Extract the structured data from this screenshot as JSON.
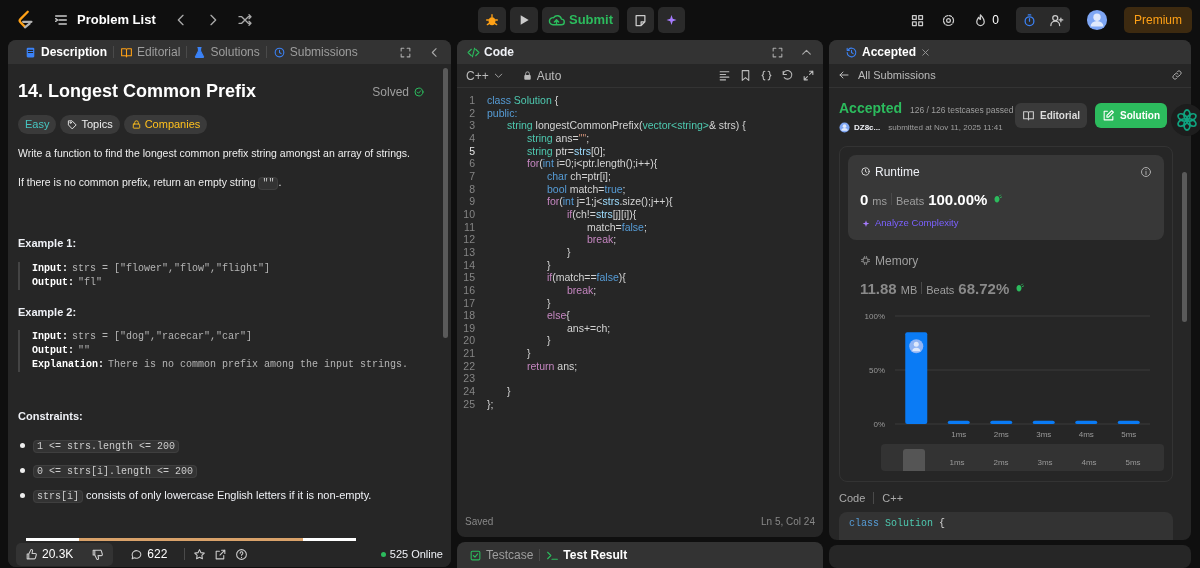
{
  "topbar": {
    "problem_list": "Problem List",
    "submit": "Submit",
    "streak": "0",
    "premium": "Premium"
  },
  "left_panel": {
    "tabs": [
      {
        "label": "Description",
        "selected": true
      },
      {
        "label": "Editorial",
        "selected": false
      },
      {
        "label": "Solutions",
        "selected": false
      },
      {
        "label": "Submissions",
        "selected": false
      }
    ],
    "title": "14. Longest Common Prefix",
    "status": "Solved",
    "tags": [
      {
        "label": "Easy",
        "kind": "difficulty"
      },
      {
        "label": "Topics",
        "kind": "topics"
      },
      {
        "label": "Companies",
        "kind": "locked"
      }
    ],
    "paragraphs": [
      [
        {
          "kind": "text",
          "text": "Write a function to find the longest common prefix string amongst an array of strings."
        }
      ],
      [
        {
          "kind": "text",
          "text": "If there is no common prefix, return an empty string "
        },
        {
          "kind": "code",
          "text": "\"\""
        },
        {
          "kind": "text",
          "text": "."
        }
      ]
    ],
    "examples": [
      {
        "heading": "Example 1:",
        "lines": [
          {
            "label": "Input:",
            "value": "strs = [\"flower\",\"flow\",\"flight\"]"
          },
          {
            "label": "Output:",
            "value": "\"fl\""
          }
        ]
      },
      {
        "heading": "Example 2:",
        "lines": [
          {
            "label": "Input:",
            "value": "strs = [\"dog\",\"racecar\",\"car\"]"
          },
          {
            "label": "Output:",
            "value": "\"\""
          },
          {
            "label": "Explanation:",
            "value": "There is no common prefix among the input strings."
          }
        ]
      }
    ],
    "constraints_heading": "Constraints:",
    "constraints": [
      [
        {
          "kind": "code",
          "text": "1 <= strs.length <= 200"
        }
      ],
      [
        {
          "kind": "code",
          "text": "0 <= strs[i].length <= 200"
        }
      ],
      [
        {
          "kind": "code",
          "text": "strs[i]"
        },
        {
          "kind": "text",
          "text": " consists of only lowercase English letters if it is non-empty."
        }
      ]
    ],
    "footer": {
      "likes": "20.3K",
      "comments": "622",
      "online": "525 Online"
    }
  },
  "code_panel": {
    "title": "Code",
    "language": "C++",
    "mode": "Auto",
    "status": "Saved",
    "cursor": "Ln 5, Col 24",
    "lines": [
      {
        "number": "1",
        "current": false,
        "tokens": [
          {
            "kind": "k",
            "text": "class "
          },
          {
            "kind": "t",
            "text": "Solution"
          },
          {
            "kind": "p",
            "text": " {"
          }
        ]
      },
      {
        "number": "2",
        "current": false,
        "tokens": [
          {
            "kind": "k",
            "text": "public:"
          }
        ]
      },
      {
        "number": "3",
        "current": false,
        "tokens": [
          {
            "kind": "t",
            "text": "\tstring"
          },
          {
            "kind": "p",
            "text": " longestCommonPrefix("
          },
          {
            "kind": "t",
            "text": "vector<string>"
          },
          {
            "kind": "p",
            "text": "& strs) {"
          }
        ]
      },
      {
        "number": "4",
        "current": false,
        "tokens": [
          {
            "kind": "t",
            "text": "\t\tstring"
          },
          {
            "kind": "p",
            "text": " ans="
          },
          {
            "kind": "s",
            "text": "\"\""
          },
          {
            "kind": "p",
            "text": ";"
          }
        ]
      },
      {
        "number": "5",
        "current": true,
        "tokens": [
          {
            "kind": "t",
            "text": "\t\tstring"
          },
          {
            "kind": "p",
            "text": " ptr="
          },
          {
            "kind": "v",
            "text": "strs"
          },
          {
            "kind": "p",
            "text": "[0];"
          }
        ]
      },
      {
        "number": "6",
        "current": false,
        "tokens": [
          {
            "kind": "c",
            "text": "\t\tfor"
          },
          {
            "kind": "p",
            "text": "("
          },
          {
            "kind": "k",
            "text": "int"
          },
          {
            "kind": "p",
            "text": " i=0;i<ptr.length();i++){"
          }
        ]
      },
      {
        "number": "7",
        "current": false,
        "tokens": [
          {
            "kind": "k",
            "text": "\t\t\tchar"
          },
          {
            "kind": "p",
            "text": " ch=ptr[i];"
          }
        ]
      },
      {
        "number": "8",
        "current": false,
        "tokens": [
          {
            "kind": "k",
            "text": "\t\t\tbool"
          },
          {
            "kind": "p",
            "text": " match="
          },
          {
            "kind": "k",
            "text": "true"
          },
          {
            "kind": "p",
            "text": ";"
          }
        ]
      },
      {
        "number": "9",
        "current": false,
        "tokens": [
          {
            "kind": "c",
            "text": "\t\t\tfor"
          },
          {
            "kind": "p",
            "text": "("
          },
          {
            "kind": "k",
            "text": "int"
          },
          {
            "kind": "p",
            "text": " j=1;j<"
          },
          {
            "kind": "v",
            "text": "strs"
          },
          {
            "kind": "p",
            "text": ".size();j++){"
          }
        ]
      },
      {
        "number": "10",
        "current": false,
        "tokens": [
          {
            "kind": "c",
            "text": "\t\t\t\tif"
          },
          {
            "kind": "p",
            "text": "(ch!="
          },
          {
            "kind": "v",
            "text": "strs"
          },
          {
            "kind": "p",
            "text": "[j][i]){"
          }
        ]
      },
      {
        "number": "11",
        "current": false,
        "tokens": [
          {
            "kind": "p",
            "text": "\t\t\t\t\tmatch="
          },
          {
            "kind": "k",
            "text": "false"
          },
          {
            "kind": "p",
            "text": ";"
          }
        ]
      },
      {
        "number": "12",
        "current": false,
        "tokens": [
          {
            "kind": "c",
            "text": "\t\t\t\t\tbreak"
          },
          {
            "kind": "p",
            "text": ";"
          }
        ]
      },
      {
        "number": "13",
        "current": false,
        "tokens": [
          {
            "kind": "p",
            "text": "\t\t\t\t}"
          }
        ]
      },
      {
        "number": "14",
        "current": false,
        "tokens": [
          {
            "kind": "p",
            "text": "\t\t\t}"
          }
        ]
      },
      {
        "number": "15",
        "current": false,
        "tokens": [
          {
            "kind": "c",
            "text": "\t\t\tif"
          },
          {
            "kind": "p",
            "text": "(match=="
          },
          {
            "kind": "k",
            "text": "false"
          },
          {
            "kind": "p",
            "text": "){"
          }
        ]
      },
      {
        "number": "16",
        "current": false,
        "tokens": [
          {
            "kind": "c",
            "text": "\t\t\t\tbreak"
          },
          {
            "kind": "p",
            "text": ";"
          }
        ]
      },
      {
        "number": "17",
        "current": false,
        "tokens": [
          {
            "kind": "p",
            "text": "\t\t\t}"
          }
        ]
      },
      {
        "number": "18",
        "current": false,
        "tokens": [
          {
            "kind": "c",
            "text": "\t\t\telse"
          },
          {
            "kind": "p",
            "text": "{"
          }
        ]
      },
      {
        "number": "19",
        "current": false,
        "tokens": [
          {
            "kind": "p",
            "text": "\t\t\t\tans+=ch;"
          }
        ]
      },
      {
        "number": "20",
        "current": false,
        "tokens": [
          {
            "kind": "p",
            "text": "\t\t\t}"
          }
        ]
      },
      {
        "number": "21",
        "current": false,
        "tokens": [
          {
            "kind": "p",
            "text": "\t\t}"
          }
        ]
      },
      {
        "number": "22",
        "current": false,
        "tokens": [
          {
            "kind": "c",
            "text": "\t\treturn"
          },
          {
            "kind": "p",
            "text": " ans;"
          }
        ]
      },
      {
        "number": "23",
        "current": false
      },
      {
        "number": "24",
        "current": false,
        "tokens": [
          {
            "kind": "p",
            "text": "\t}"
          }
        ]
      },
      {
        "number": "25",
        "current": false,
        "tokens": [
          {
            "kind": "p",
            "text": "};"
          }
        ]
      }
    ]
  },
  "bottom_tabs": [
    {
      "label": "Testcase",
      "selected": false
    },
    {
      "label": "Test Result",
      "selected": true
    }
  ],
  "right_panel": {
    "tab": "Accepted",
    "back": "All Submissions",
    "result": {
      "status": "Accepted",
      "testcases": "126 / 126 testcases passed",
      "user": "DZ8c...",
      "submitted": "submitted at Nov 11, 2025 11:41"
    },
    "buttons": [
      {
        "label": "Editorial",
        "kind": "secondary"
      },
      {
        "label": "Solution",
        "kind": "primary"
      }
    ],
    "metrics": [
      {
        "title": "Runtime",
        "value": "0",
        "unit": "ms",
        "beats_label": "Beats",
        "beats": "100.00%",
        "selected": true,
        "action": "Analyze Complexity"
      },
      {
        "title": "Memory",
        "value": "11.88",
        "unit": "MB",
        "beats_label": "Beats",
        "beats": "68.72%",
        "selected": false
      }
    ],
    "chart_data": {
      "type": "bar",
      "categories": [
        null,
        "1ms",
        "2ms",
        "3ms",
        "4ms",
        "5ms"
      ],
      "series": [
        {
          "color": "#0a7bf5",
          "values": [
            85,
            3,
            3,
            3,
            3,
            3
          ]
        }
      ],
      "ylim": [
        0,
        100
      ],
      "yticks": [
        {
          "value": 0,
          "label": "0%"
        },
        {
          "value": 50,
          "label": "50%"
        },
        {
          "value": 100,
          "label": "100%"
        }
      ]
    },
    "navigator_labels": [
      "1ms",
      "2ms",
      "3ms",
      "4ms",
      "5ms"
    ],
    "code_label": "Code",
    "code_language": "C++",
    "code_preview": [
      [
        {
          "kind": "k",
          "text": "class "
        },
        {
          "kind": "t",
          "text": "Solution"
        },
        {
          "kind": "p",
          "text": " {"
        }
      ]
    ]
  }
}
